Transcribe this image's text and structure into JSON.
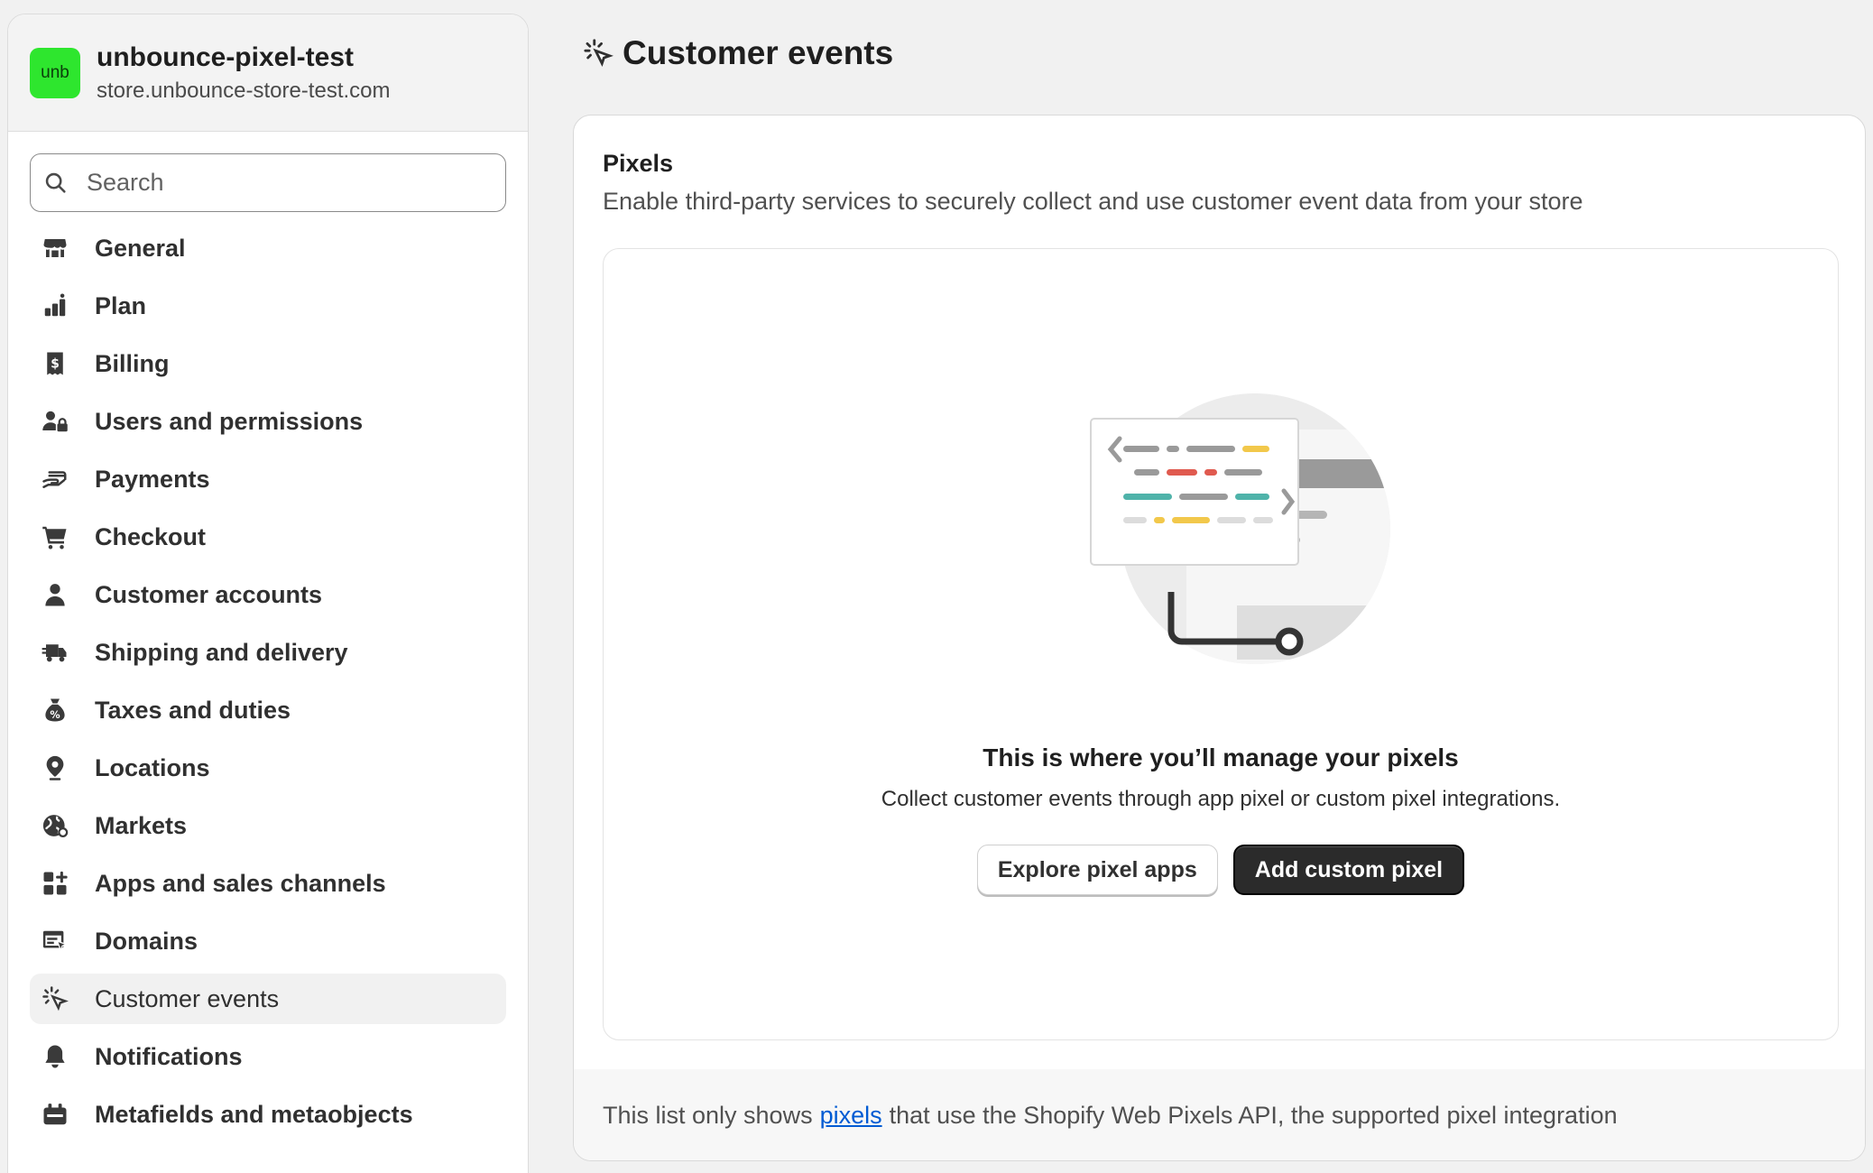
{
  "store": {
    "logo_text": "unb",
    "name": "unbounce-pixel-test",
    "domain": "store.unbounce-store-test.com",
    "logo_color": "#2ee62e"
  },
  "search": {
    "placeholder": "Search",
    "value": ""
  },
  "nav": {
    "items": [
      {
        "label": "General",
        "icon": "store-icon"
      },
      {
        "label": "Plan",
        "icon": "plan-icon"
      },
      {
        "label": "Billing",
        "icon": "receipt-dollar-icon"
      },
      {
        "label": "Users and permissions",
        "icon": "users-lock-icon"
      },
      {
        "label": "Payments",
        "icon": "payment-hand-icon"
      },
      {
        "label": "Checkout",
        "icon": "cart-icon"
      },
      {
        "label": "Customer accounts",
        "icon": "person-icon"
      },
      {
        "label": "Shipping and delivery",
        "icon": "truck-icon"
      },
      {
        "label": "Taxes and duties",
        "icon": "tax-bag-icon"
      },
      {
        "label": "Locations",
        "icon": "location-pin-icon"
      },
      {
        "label": "Markets",
        "icon": "globe-icon"
      },
      {
        "label": "Apps and sales channels",
        "icon": "apps-icon"
      },
      {
        "label": "Domains",
        "icon": "domain-icon"
      },
      {
        "label": "Customer events",
        "icon": "cursor-click-icon",
        "active": true
      },
      {
        "label": "Notifications",
        "icon": "bell-icon"
      },
      {
        "label": "Metafields and metaobjects",
        "icon": "metafields-icon"
      }
    ]
  },
  "page": {
    "title": "Customer events",
    "title_icon": "cursor-click-icon"
  },
  "pixels": {
    "title": "Pixels",
    "description": "Enable third-party services to securely collect and use customer event data from your store",
    "empty_state": {
      "title": "This is where you’ll manage your pixels",
      "description": "Collect customer events through app pixel or custom pixel integrations.",
      "secondary_button": "Explore pixel apps",
      "primary_button": "Add custom pixel"
    },
    "footer": {
      "prefix": "This list only shows",
      "link": "pixels",
      "suffix": "that use the Shopify Web Pixels API, the supported pixel integration",
      "link_color": "#005bd3"
    }
  }
}
